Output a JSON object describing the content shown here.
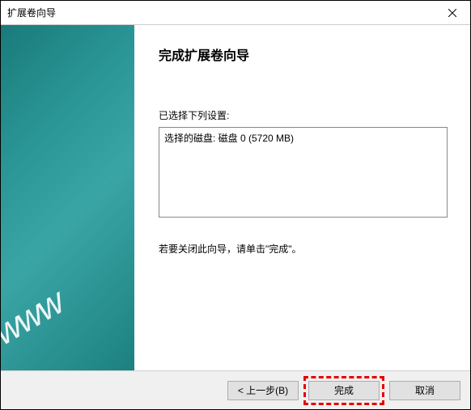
{
  "window": {
    "title": "扩展卷向导"
  },
  "sidebar": {
    "watermark": "www"
  },
  "main": {
    "heading": "完成扩展卷向导",
    "settings_label": "已选择下列设置:",
    "listbox_text": "选择的磁盘: 磁盘 0 (5720 MB)",
    "instruction": "若要关闭此向导，请单击\"完成\"。"
  },
  "footer": {
    "back_label": "< 上一步(B)",
    "finish_label": "完成",
    "cancel_label": "取消"
  }
}
